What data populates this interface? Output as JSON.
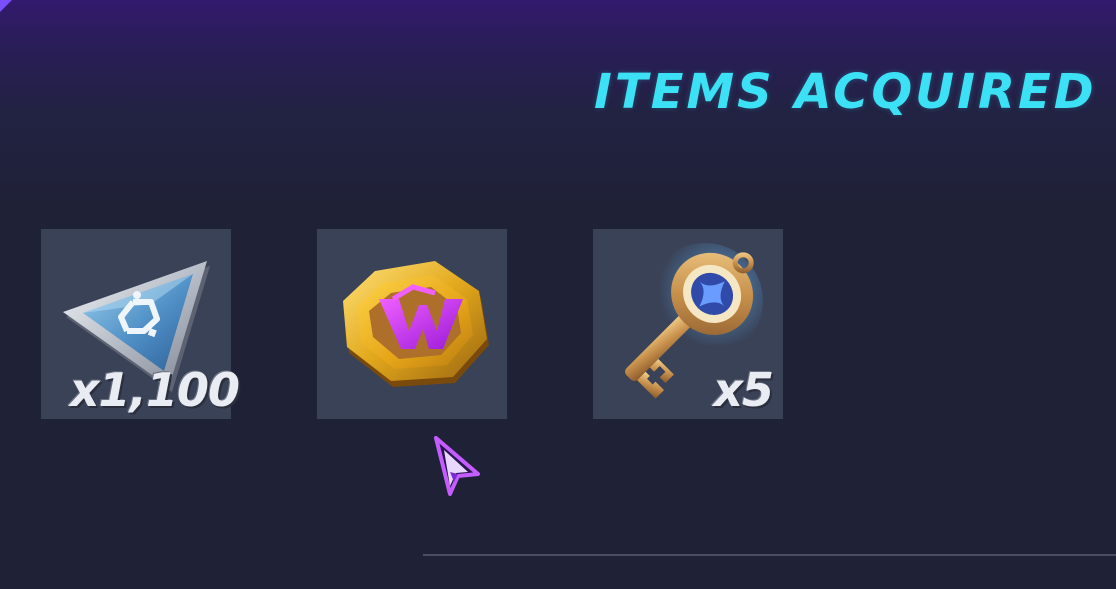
{
  "header": {
    "title": "ITEMS ACQUIRED"
  },
  "items": [
    {
      "name": "triangle-token",
      "icon": "triangle-token-icon",
      "quantity": "x1,100"
    },
    {
      "name": "w-coin",
      "icon": "w-coin-icon",
      "quantity": ""
    },
    {
      "name": "key",
      "icon": "key-icon",
      "quantity": "x5"
    }
  ],
  "colors": {
    "title": "#3ce1f5",
    "slot_bg": "#3a4257",
    "background": "#1f2136",
    "accent": "#7a4dff"
  }
}
